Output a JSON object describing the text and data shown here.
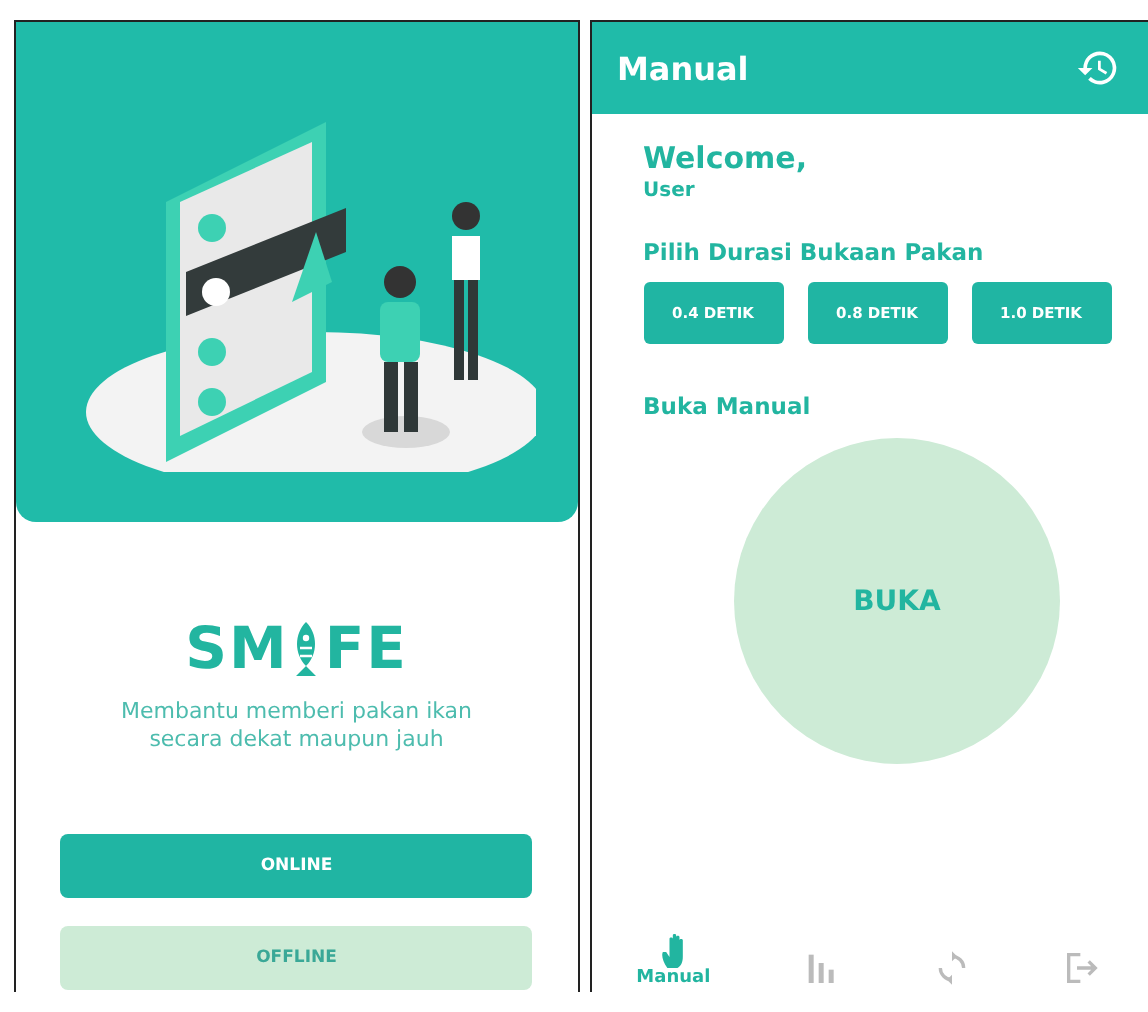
{
  "welcome_screen": {
    "logo": {
      "left": "SM",
      "right": "FE"
    },
    "tagline": "Membantu memberi pakan ikan secara dekat maupun jauh",
    "buttons": [
      {
        "label": "ONLINE",
        "kind": "primary"
      },
      {
        "label": "OFFLINE",
        "kind": "secondary"
      }
    ]
  },
  "manual_screen": {
    "title": "Manual",
    "greeting": "Welcome,",
    "user": "User",
    "duration_heading": "Pilih Durasi Bukaan Pakan",
    "durations": [
      "0.4 DETIK",
      "0.8 DETIK",
      "1.0 DETIK"
    ],
    "manual_heading": "Buka Manual",
    "open_button": "BUKA",
    "nav": [
      {
        "kind": "hand",
        "label": "Manual",
        "selected": true
      },
      {
        "kind": "chart",
        "selected": false
      },
      {
        "kind": "refresh",
        "selected": false
      },
      {
        "kind": "logout",
        "selected": false
      }
    ]
  }
}
